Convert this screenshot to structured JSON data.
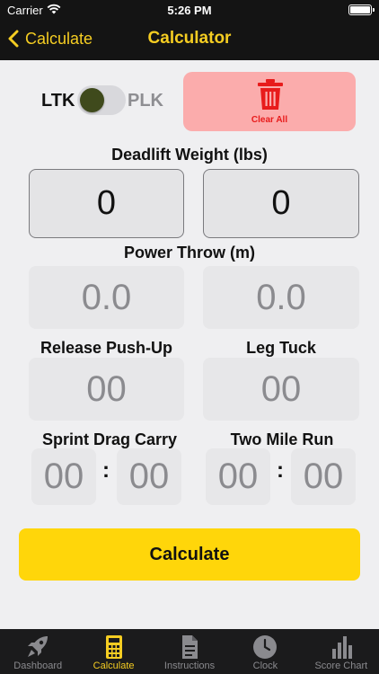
{
  "status_bar": {
    "carrier": "Carrier",
    "time": "5:26 PM"
  },
  "nav": {
    "back_label": "Calculate",
    "title": "Calculator"
  },
  "toggle": {
    "left_label": "LTK",
    "right_label": "PLK",
    "selected": "LTK"
  },
  "clear_all": {
    "label": "Clear All",
    "color": "#e81b1b"
  },
  "deadlift": {
    "label": "Deadlift Weight (lbs)",
    "values": [
      "0",
      "0"
    ]
  },
  "power_throw": {
    "label": "Power Throw (m)",
    "placeholders": [
      "0.0",
      "0.0"
    ]
  },
  "release_pushup": {
    "label": "Release Push-Up",
    "placeholder": "00"
  },
  "leg_tuck": {
    "label": "Leg Tuck",
    "placeholder": "00"
  },
  "sprint_drag_carry": {
    "label": "Sprint Drag Carry",
    "minutes_placeholder": "00",
    "seconds_placeholder": "00",
    "separator": ":"
  },
  "two_mile_run": {
    "label": "Two Mile Run",
    "minutes_placeholder": "00",
    "seconds_placeholder": "00",
    "separator": ":"
  },
  "calculate_button": {
    "label": "Calculate",
    "color": "#ffd60a"
  },
  "tabbar": {
    "accent": "#f5cd22",
    "items": [
      {
        "label": "Dashboard",
        "icon": "rocket-icon"
      },
      {
        "label": "Calculate",
        "icon": "calculator-icon",
        "active": true
      },
      {
        "label": "Instructions",
        "icon": "document-icon"
      },
      {
        "label": "Clock",
        "icon": "clock-icon"
      },
      {
        "label": "Score Chart",
        "icon": "bar-chart-icon"
      }
    ]
  }
}
